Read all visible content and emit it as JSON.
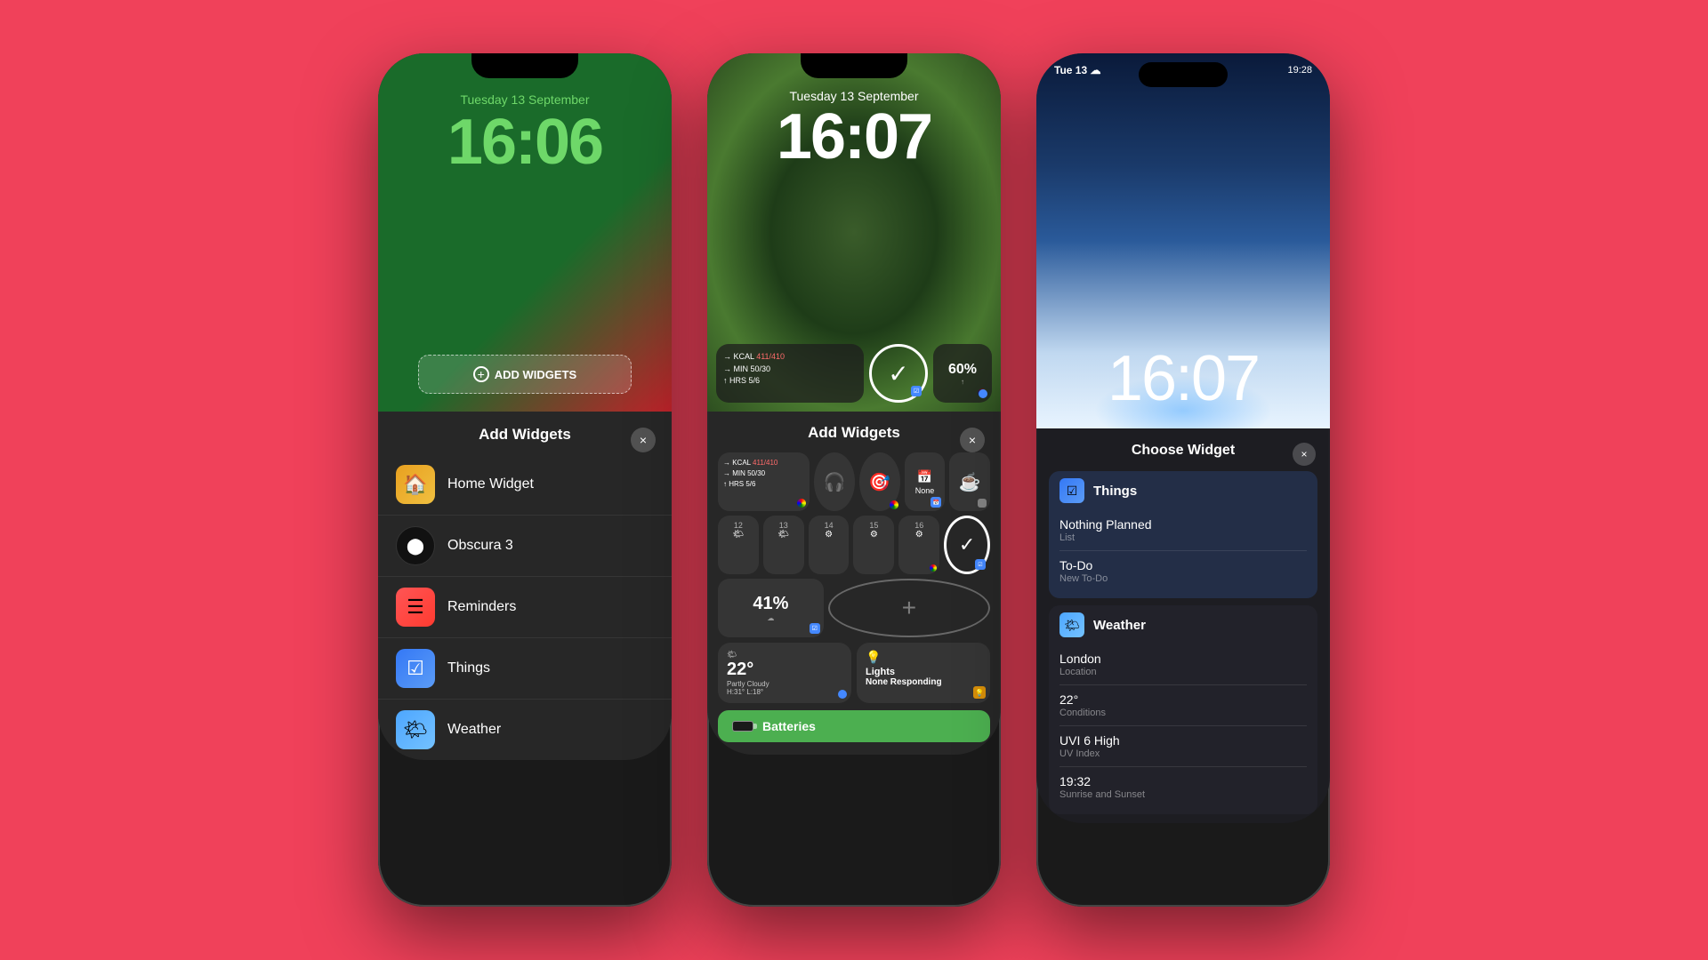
{
  "background": "#f0415a",
  "phone1": {
    "wallpaper_colors": [
      "#1a6b2a",
      "#c0222a"
    ],
    "date": "Tuesday 13 September",
    "time": "16:06",
    "add_widgets_label": "ADD WIDGETS",
    "drawer_title": "Add Widgets",
    "close_label": "×",
    "items": [
      {
        "name": "Home Widget",
        "icon": "🏠",
        "icon_class": "home"
      },
      {
        "name": "Obscura 3",
        "icon": "⬤",
        "icon_class": "obscura"
      },
      {
        "name": "Reminders",
        "icon": "📋",
        "icon_class": "reminders"
      },
      {
        "name": "Things",
        "icon": "☑",
        "icon_class": "things"
      },
      {
        "name": "Weather",
        "icon": "🌤",
        "icon_class": "weather"
      }
    ]
  },
  "phone2": {
    "date": "Tuesday 13 September",
    "time": "16:07",
    "drawer_title": "Add Widgets",
    "close_label": "×",
    "workout": {
      "kcal": "411/410",
      "min": "50/30",
      "hrs": "5/6"
    },
    "check_label": "✓",
    "percent_label": "60%",
    "percent2_label": "41%",
    "none_label": "None",
    "dates": [
      "12",
      "13",
      "14",
      "15",
      "16"
    ],
    "weather": {
      "temp": "22°",
      "desc": "Partly Cloudy",
      "range": "H:31° L:18°"
    },
    "lights": {
      "icon": "💡",
      "label": "Lights",
      "status": "None Responding"
    },
    "batteries_label": "Batteries"
  },
  "phone3": {
    "status_date": "Tue 13",
    "status_time": "19:28",
    "status_icon": "☁",
    "date": "Tue 13",
    "time": "16:07",
    "drawer_title": "Choose Widget",
    "close_label": "×",
    "things": {
      "label": "Things",
      "items": [
        {
          "name": "Nothing Planned",
          "sub": "List"
        },
        {
          "name": "To-Do",
          "sub": "New To-Do"
        }
      ]
    },
    "weather": {
      "label": "Weather",
      "items": [
        {
          "name": "London",
          "sub": "Location"
        },
        {
          "name": "22°",
          "sub": "Conditions"
        },
        {
          "name": "UVI 6 High",
          "sub": "UV Index"
        },
        {
          "name": "19:32",
          "sub": "Sunrise and Sunset"
        }
      ]
    }
  }
}
